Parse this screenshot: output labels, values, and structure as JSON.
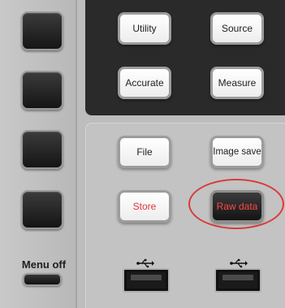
{
  "left_panel": {
    "softkeys": [
      "softkey-1",
      "softkey-2",
      "softkey-3",
      "softkey-4"
    ],
    "menu_off_label": "Menu off"
  },
  "top_group": {
    "utility_label": "Utility",
    "source_label": "Source",
    "accurate_label": "Accurate",
    "measure_label": "Measure"
  },
  "bottom_group": {
    "file_label": "File",
    "image_save_label": "Image save",
    "store_label": "Store",
    "raw_data_label": "Raw data",
    "highlighted": "Raw data"
  },
  "usb": {
    "icon": "usb-icon",
    "ports": 2
  },
  "colors": {
    "highlight": "#d93a3a",
    "store_text": "#e0333a",
    "raw_data_text": "#ff4a4a"
  }
}
